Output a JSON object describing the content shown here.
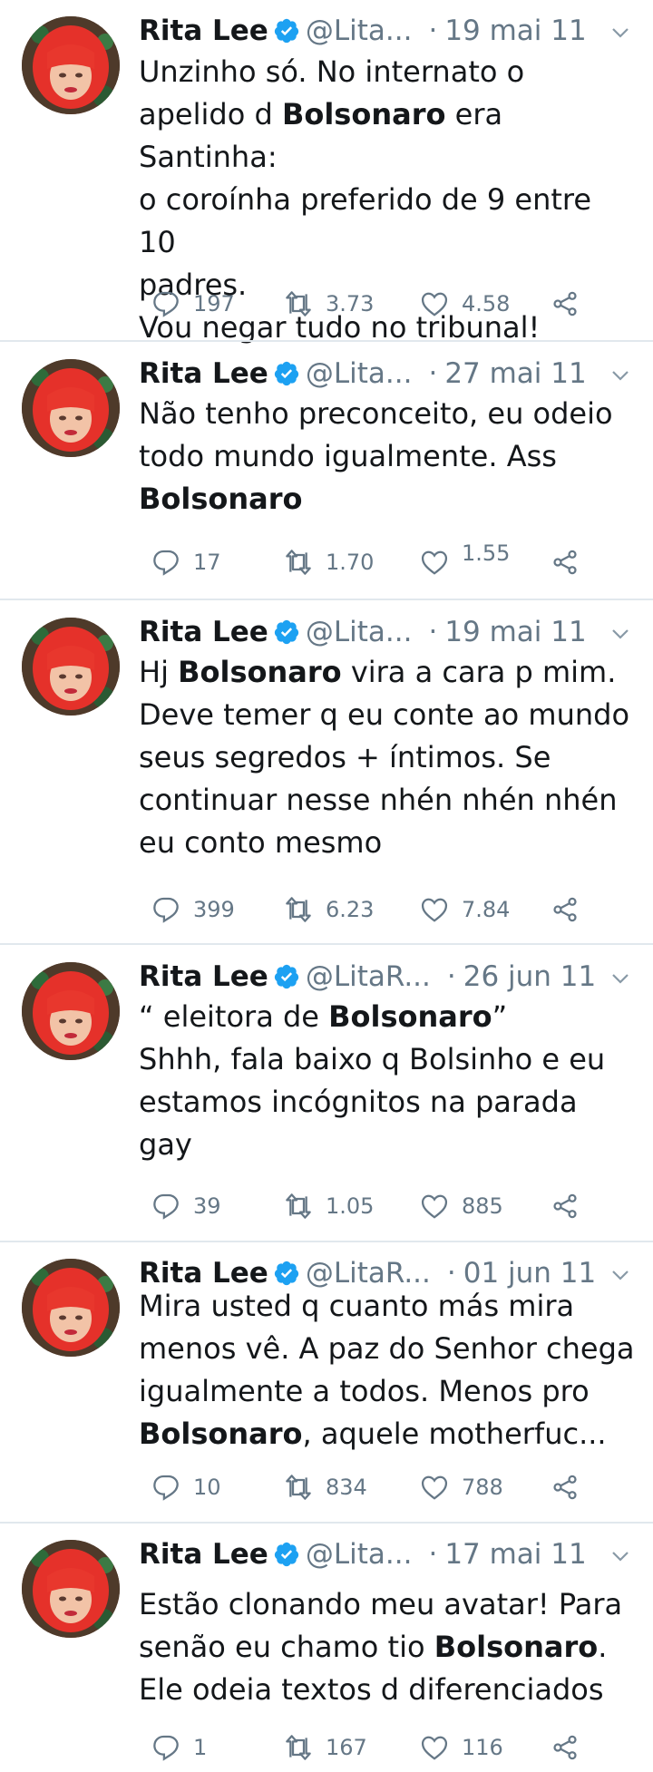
{
  "tweets": [
    {
      "name": "Rita Lee",
      "handle": "@Lita...",
      "dot": "·",
      "date": "19 mai 11",
      "lines": [
        [
          {
            "t": "Unzinho só. No internato o"
          }
        ],
        [
          {
            "t": "apelido d "
          },
          {
            "t": "Bolsonaro",
            "b": true
          },
          {
            "t": " era Santinha:"
          }
        ],
        [
          {
            "t": "o coroínha preferido de 9 entre 10"
          }
        ],
        [
          {
            "t": "padres."
          }
        ],
        [
          {
            "t": "Vou negar tudo no tribunal!"
          }
        ]
      ],
      "replies": "197",
      "retweets": "3.73",
      "likes": "4.58"
    },
    {
      "name": "Rita Lee",
      "handle": "@Lita...",
      "dot": "·",
      "date": "27 mai 11",
      "lines": [
        [
          {
            "t": "Não tenho preconceito, eu odeio"
          }
        ],
        [
          {
            "t": "todo mundo igualmente. Ass"
          }
        ],
        [
          {
            "t": "Bolsonaro",
            "b": true
          }
        ]
      ],
      "replies": "17",
      "retweets": "1.70",
      "likes": "1.55"
    },
    {
      "name": "Rita Lee",
      "handle": "@Lita...",
      "dot": "·",
      "date": "19 mai 11",
      "lines": [
        [
          {
            "t": "Hj "
          },
          {
            "t": "Bolsonaro",
            "b": true
          },
          {
            "t": " vira a cara p mim."
          }
        ],
        [
          {
            "t": "Deve temer q eu conte ao mundo"
          }
        ],
        [
          {
            "t": "seus segredos + íntimos. Se"
          }
        ],
        [
          {
            "t": "continuar nesse nhén nhén nhén"
          }
        ],
        [
          {
            "t": "eu conto mesmo"
          }
        ]
      ],
      "replies": "399",
      "retweets": "6.23",
      "likes": "7.84"
    },
    {
      "name": "Rita Lee",
      "handle": "@LitaR...",
      "dot": "·",
      "date": "26 jun 11",
      "lines": [
        [
          {
            "t": "“ eleitora de "
          },
          {
            "t": "Bolsonaro",
            "b": true
          },
          {
            "t": "”"
          }
        ],
        [
          {
            "t": "Shhh, fala baixo q Bolsinho e eu"
          }
        ],
        [
          {
            "t": "estamos incógnitos na parada"
          }
        ],
        [
          {
            "t": "gay"
          }
        ]
      ],
      "replies": "39",
      "retweets": "1.05",
      "likes": "885"
    },
    {
      "name": "Rita Lee",
      "handle": "@LitaR...",
      "dot": "·",
      "date": "01 jun 11",
      "lines": [
        [
          {
            "t": "Mira usted q cuanto más mira"
          }
        ],
        [
          {
            "t": "menos vê. A paz do Senhor chega"
          }
        ],
        [
          {
            "t": "igualmente a todos. Menos pro"
          }
        ],
        [
          {
            "t": "Bolsonaro",
            "b": true
          },
          {
            "t": ", aquele motherfuc..."
          }
        ]
      ],
      "replies": "10",
      "retweets": "834",
      "likes": "788"
    },
    {
      "name": "Rita Lee",
      "handle": "@Lita...",
      "dot": "·",
      "date": "17 mai 11",
      "lines": [
        [
          {
            "t": "Estão clonando meu avatar! Para"
          }
        ],
        [
          {
            "t": "senão eu chamo tio "
          },
          {
            "t": "Bolsonaro",
            "b": true
          },
          {
            "t": "."
          }
        ],
        [
          {
            "t": "Ele odeia textos d diferenciados"
          }
        ]
      ],
      "replies": "1",
      "retweets": "167",
      "likes": "116"
    }
  ],
  "colors": {
    "verified": "#1da1f2",
    "secondary": "#657786",
    "divider": "#e1e8ed"
  },
  "icons": [
    "verified-badge-icon",
    "chevron-down-icon",
    "reply-icon",
    "retweet-icon",
    "like-icon",
    "share-icon"
  ]
}
